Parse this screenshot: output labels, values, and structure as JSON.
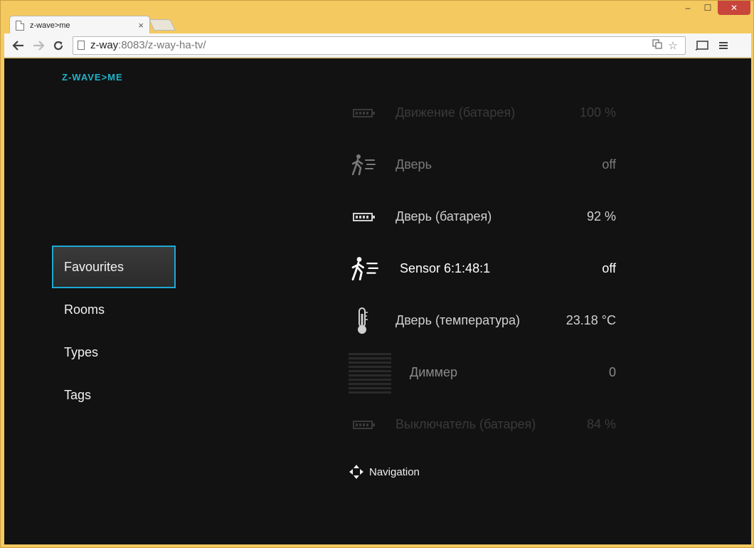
{
  "window": {
    "minimize": "–",
    "maximize": "☐",
    "close": "✕"
  },
  "tab": {
    "title": "z-wave>me",
    "close": "×"
  },
  "toolbar": {
    "url_host": "z-way",
    "url_rest": ":8083/z-way-ha-tv/",
    "icons": [
      "back-icon",
      "forward-icon",
      "reload-icon",
      "translate-icon",
      "star-icon",
      "cast-icon",
      "menu-icon"
    ]
  },
  "app": {
    "logo": "Z-WAVE>ME",
    "menu": [
      {
        "label": "Favourites",
        "active": true
      },
      {
        "label": "Rooms"
      },
      {
        "label": "Types"
      },
      {
        "label": "Tags"
      }
    ],
    "devices": [
      {
        "label": "Движение (батарея)",
        "value": "100 %",
        "icon": "battery-icon"
      },
      {
        "label": "Дверь",
        "value": "off",
        "icon": "motion-sensor-icon"
      },
      {
        "label": "Дверь (батарея)",
        "value": "92 %",
        "icon": "battery-icon"
      },
      {
        "label": "Sensor 6:1:48:1",
        "value": "off",
        "icon": "motion-sensor-icon"
      },
      {
        "label": "Дверь (температура)",
        "value": "23.18 °C",
        "icon": "thermometer-icon"
      },
      {
        "label": "Диммер",
        "value": "0",
        "icon": "dimmer-icon"
      },
      {
        "label": "Выключатель (батарея)",
        "value": "84 %",
        "icon": "battery-icon"
      }
    ],
    "navigation_label": "Navigation"
  },
  "colors": {
    "accent": "#1ca9d6",
    "logo": "#1fb3c9",
    "background": "#121212",
    "frame": "#f4c95f"
  }
}
